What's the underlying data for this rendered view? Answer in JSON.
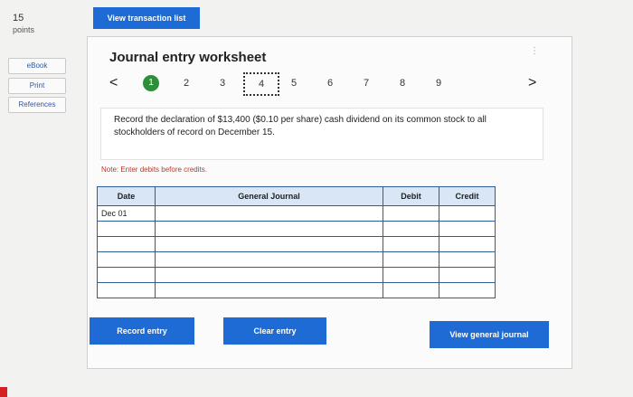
{
  "points": {
    "value": "15",
    "label": "points"
  },
  "sidebar": {
    "ebook": "eBook",
    "print": "Print",
    "references": "References"
  },
  "header": {
    "view_transaction_list": "View transaction list"
  },
  "worksheet": {
    "title": "Journal entry worksheet",
    "more": "⋮",
    "nav": {
      "prev": "<",
      "next": ">",
      "steps": [
        "1",
        "2",
        "3",
        "4",
        "5",
        "6",
        "7",
        "8",
        "9"
      ],
      "active_step": "1",
      "current_step": "4"
    },
    "instruction": "Record the declaration of $13,400 ($0.10 per share) cash dividend on its common stock to all stockholders of record on December 15.",
    "note": "Note: Enter debits before credits.",
    "table": {
      "headers": {
        "date": "Date",
        "journal": "General Journal",
        "debit": "Debit",
        "credit": "Credit"
      },
      "rows": [
        {
          "date": "Dec 01",
          "journal": "",
          "debit": "",
          "credit": ""
        },
        {
          "date": "",
          "journal": "",
          "debit": "",
          "credit": ""
        },
        {
          "date": "",
          "journal": "",
          "debit": "",
          "credit": ""
        },
        {
          "date": "",
          "journal": "",
          "debit": "",
          "credit": ""
        },
        {
          "date": "",
          "journal": "",
          "debit": "",
          "credit": ""
        },
        {
          "date": "",
          "journal": "",
          "debit": "",
          "credit": ""
        }
      ]
    },
    "buttons": {
      "record": "Record entry",
      "clear": "Clear entry",
      "view_general": "View general journal"
    }
  },
  "colors": {
    "primary": "#1e6bd6",
    "active_step": "#2d8f3a",
    "table_border": "#2c5e9b",
    "note": "#b23b2a"
  }
}
